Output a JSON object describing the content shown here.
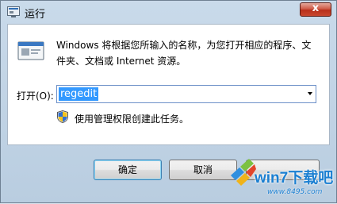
{
  "window": {
    "title": "运行",
    "close_glyph": "x"
  },
  "dialog": {
    "description": "Windows 将根据您所输入的名称，为您打开相应的程序、文件夹、文档或 Internet 资源。",
    "open_label": "打开(O):",
    "input_value": "regedit",
    "admin_note": "使用管理权限创建此任务。"
  },
  "buttons": {
    "ok": "确定",
    "cancel": "取消"
  },
  "watermark": {
    "brand": "win7下载吧",
    "url": "www.8495.com"
  },
  "icons": {
    "app": "run-app-icon",
    "dialog": "run-program-icon",
    "shield": "uac-shield-icon",
    "dropdown": "chevron-down-icon",
    "logo": "windows-logo-icon"
  },
  "colors": {
    "selection": "#3399ff",
    "close_button": "#c9482f",
    "brand": "#1b7fd1"
  }
}
